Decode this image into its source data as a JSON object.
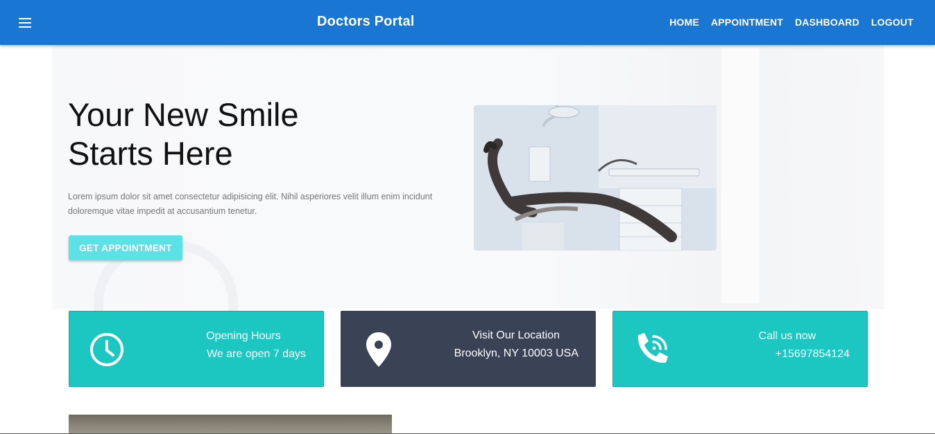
{
  "appbar": {
    "brand": "Doctors Portal",
    "nav": [
      {
        "label": "HOME"
      },
      {
        "label": "APPOINTMENT"
      },
      {
        "label": "DASHBOARD"
      },
      {
        "label": "LOGOUT"
      }
    ],
    "color": "#1976d2"
  },
  "hero": {
    "title_line1": "Your New Smile",
    "title_line2": "Starts Here",
    "description": "Lorem ipsum dolor sit amet consectetur adipisicing elit. Nihil asperiores velit illum enim incidunt doloremque vitae impedit at accusantium tenetur.",
    "cta_label": "GET APPOINTMENT",
    "cta_color": "#5ce1e6",
    "image_icon": "dental-chair-photo"
  },
  "info_cards": [
    {
      "icon": "clock-icon",
      "title": "Opening Hours",
      "detail": "We are open 7 days",
      "color": "#1cc7c1"
    },
    {
      "icon": "location-pin-icon",
      "title": "Visit Our Location",
      "detail": "Brooklyn, NY 10003 USA",
      "color": "#3a4256"
    },
    {
      "icon": "phone-wifi-icon",
      "title": "Call us now",
      "detail": "+15697854124",
      "color": "#1cc7c1"
    }
  ]
}
